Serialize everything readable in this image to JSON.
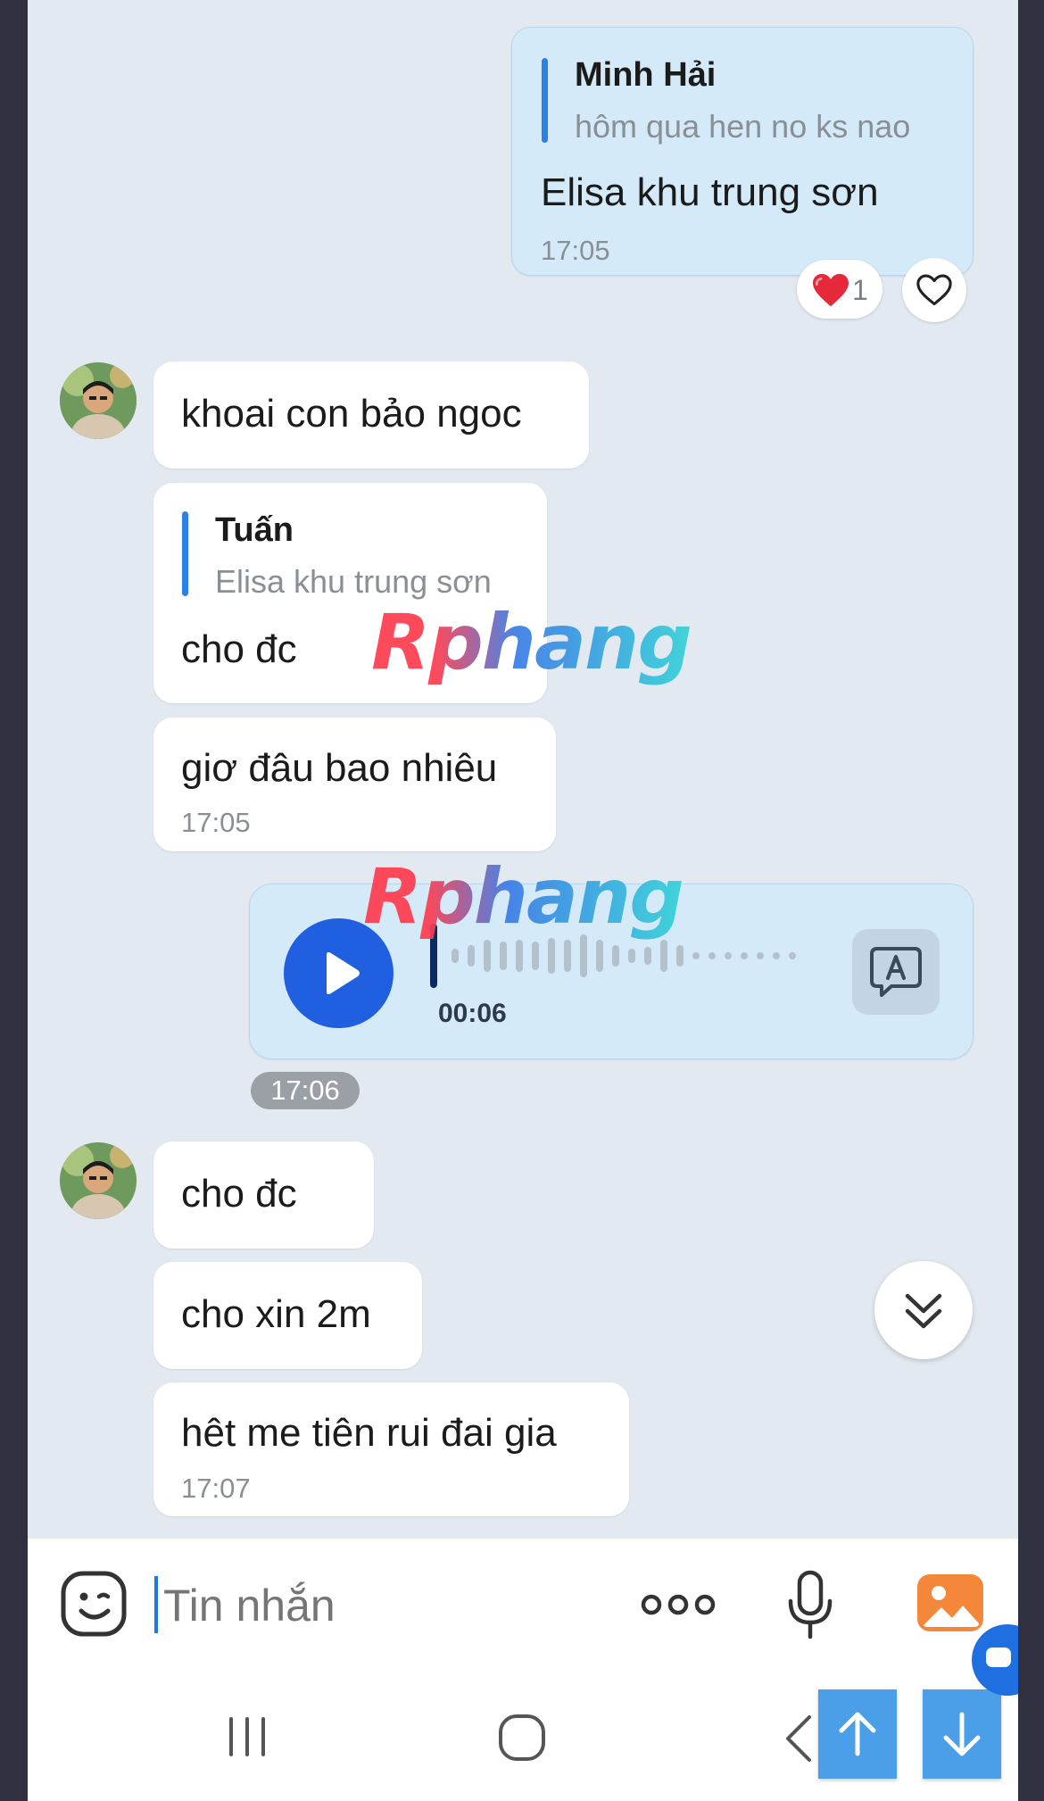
{
  "messages": {
    "m1": {
      "quote_name": "Minh Hải",
      "quote_text": "hôm qua hen no ks nao",
      "text": "Elisa khu trung sơn",
      "time": "17:05",
      "reaction_count": "1"
    },
    "m2": {
      "text": "khoai con bảo ngoc"
    },
    "m3": {
      "quote_name": "Tuấn",
      "quote_text": "Elisa khu trung sơn",
      "text": "cho đc"
    },
    "m4": {
      "text": "giơ đâu bao nhiêu",
      "time": "17:05"
    },
    "m5": {
      "duration": "00:06",
      "time": "17:06"
    },
    "m6": {
      "text": "cho đc"
    },
    "m7": {
      "text": "cho xin 2m"
    },
    "m8": {
      "text": "hêt me tiên rui đai gia",
      "time": "17:07"
    }
  },
  "watermark": "Rphang",
  "composer": {
    "placeholder": "Tin nhắn"
  },
  "icons": {
    "emoji": "emoji-icon",
    "more": "more-dots-icon",
    "mic": "microphone-icon",
    "image": "image-icon",
    "heart": "heart-icon",
    "play": "play-icon",
    "transcribe": "transcribe-icon",
    "scroll_down": "double-chevron-down-icon"
  },
  "colors": {
    "background": "#e2e9f1",
    "my_bubble": "#d5eaf9",
    "other_bubble": "#ffffff",
    "accent": "#1f5fe0",
    "quote_bar": "#2c82e4",
    "image_icon": "#f5873a"
  }
}
